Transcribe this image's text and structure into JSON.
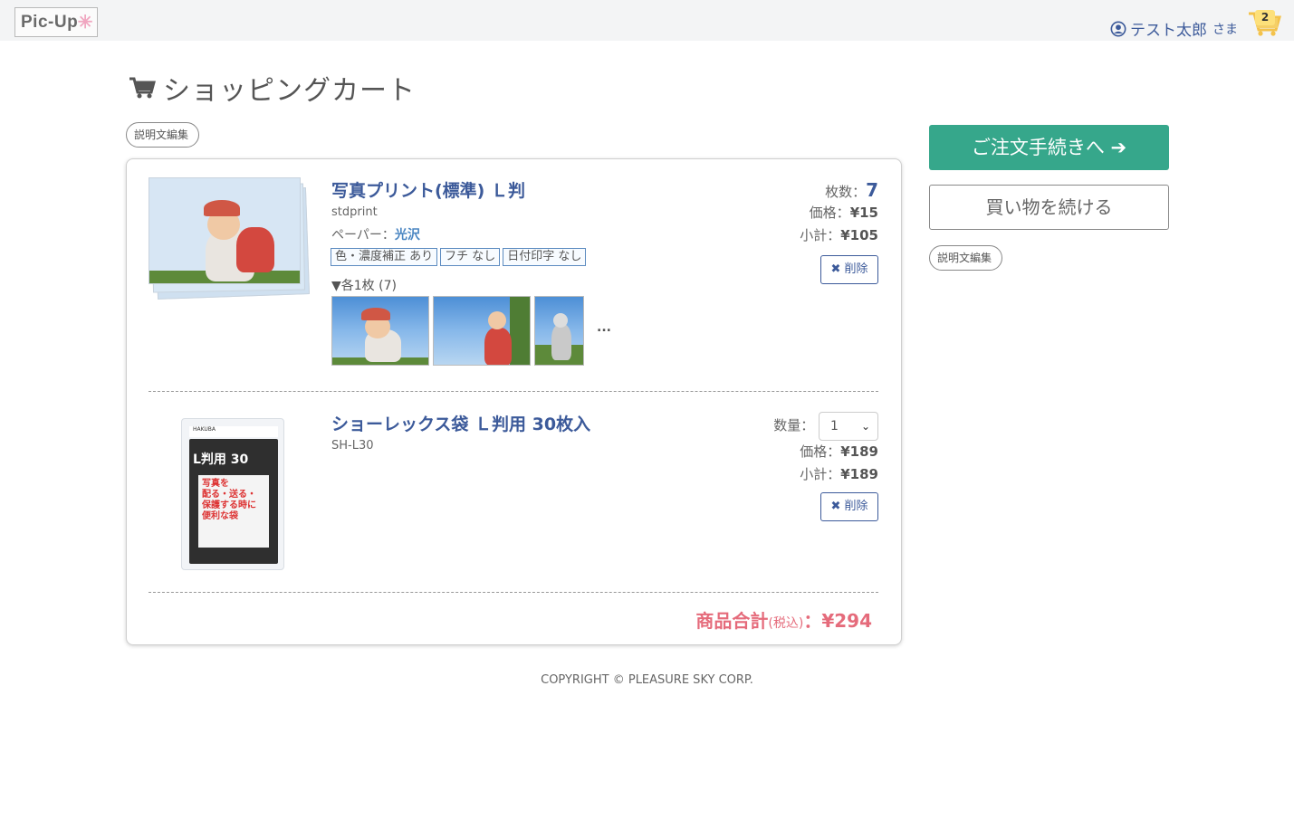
{
  "header": {
    "logo_text": "Pic-Up",
    "user_name": "テスト太郎",
    "user_suffix": "さま",
    "cart_count": "2"
  },
  "page": {
    "title": "ショッピングカート",
    "desc_edit_label": "説明文編集"
  },
  "items": [
    {
      "name": "写真プリント(標準) Ｌ判",
      "code": "stdprint",
      "paper_label": "ペーパー：",
      "paper_value": "光沢",
      "tags": [
        "色・濃度補正 あり",
        "フチ なし",
        "日付印字 なし"
      ],
      "each_label": "▼各1枚 (7)",
      "more": "...",
      "qty_label": "枚数：",
      "qty_value": "7",
      "price_label": "価格：",
      "price_value": "¥15",
      "subtotal_label": "小計：",
      "subtotal_value": "¥105",
      "delete_label": "削除"
    },
    {
      "name": "ショーレックス袋 Ｌ判用 30枚入",
      "code": "SH-L30",
      "qty_label": "数量：",
      "qty_value": "1",
      "price_label": "価格：",
      "price_value": "¥189",
      "subtotal_label": "小計：",
      "subtotal_value": "¥189",
      "delete_label": "削除"
    }
  ],
  "total": {
    "label": "商品合計",
    "tax_note": "(税込)",
    "colon": "：",
    "value": "¥294"
  },
  "sidebar": {
    "checkout_label": "ご注文手続きへ",
    "continue_label": "買い物を続ける"
  },
  "footer": {
    "copyright": "COPYRIGHT © PLEASURE SKY CORP."
  },
  "colors": {
    "brand_blue": "#3c5a9a",
    "checkout_green": "#36a78b",
    "total_pink": "#e56b7b"
  }
}
